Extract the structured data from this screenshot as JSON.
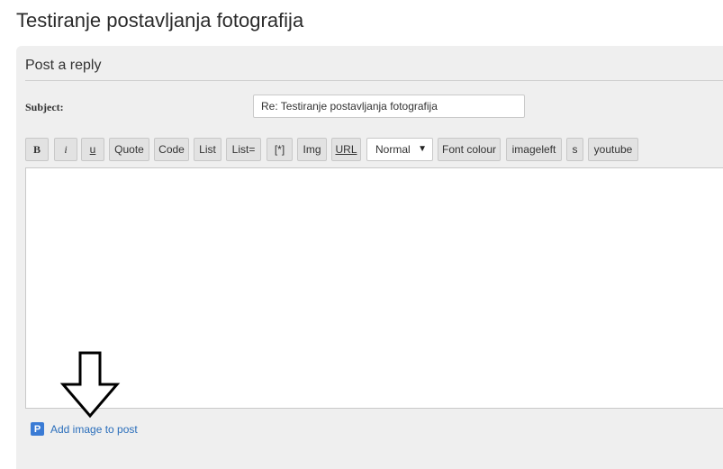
{
  "page": {
    "title": "Testiranje postavljanja fotografija"
  },
  "panel": {
    "title": "Post a reply"
  },
  "subject": {
    "label": "Subject:",
    "value": "Re: Testiranje postavljanja fotografija"
  },
  "toolbar": {
    "bold": "B",
    "italic": "i",
    "underline": "u",
    "quote": "Quote",
    "code": "Code",
    "list": "List",
    "list_ordered": "List=",
    "list_item": "[*]",
    "img": "Img",
    "url": "URL",
    "font_size": "Normal",
    "font_size_arrow": "▼",
    "font_colour": "Font colour",
    "imageleft": "imageleft",
    "s": "s",
    "youtube": "youtube"
  },
  "editor": {
    "value": ""
  },
  "add_image": {
    "icon_glyph": "P",
    "label": "Add image to post",
    "icon_color": "#3a7bd5"
  },
  "annotation": {
    "icon": "down-arrow-outline-icon"
  }
}
